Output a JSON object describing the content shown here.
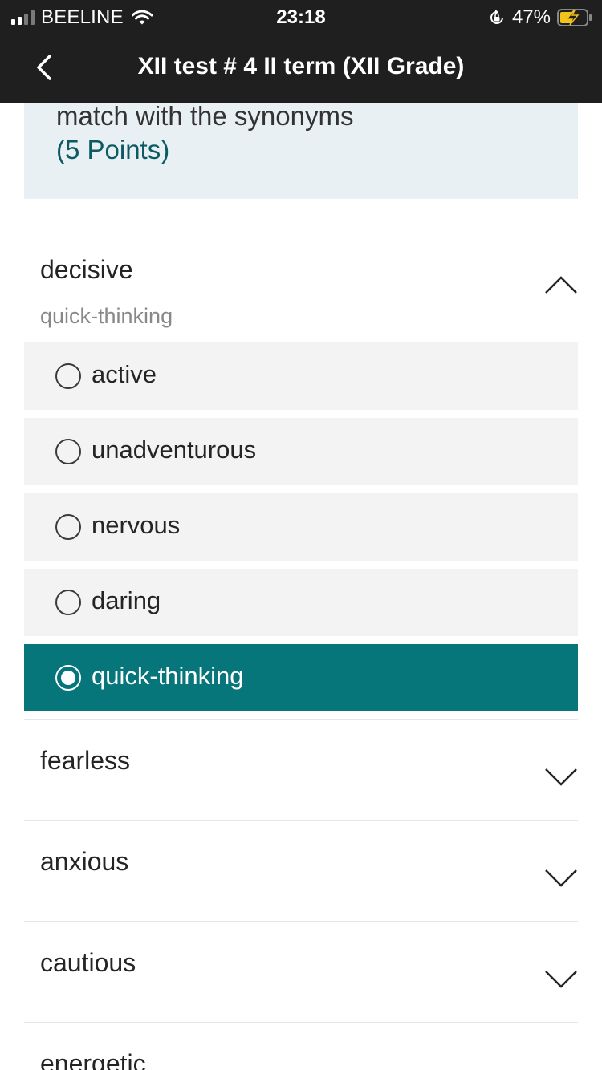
{
  "status_bar": {
    "carrier": "BEELINE",
    "time": "23:18",
    "battery": "47%"
  },
  "nav": {
    "title": "XII test # 4 II term (XII Grade)"
  },
  "question": {
    "text": "match with the synonyms",
    "points": "(5 Points)"
  },
  "match_items": [
    {
      "word": "decisive",
      "selected_answer": "quick-thinking",
      "expanded": true,
      "options": [
        {
          "label": "active",
          "selected": false
        },
        {
          "label": "unadventurous",
          "selected": false
        },
        {
          "label": "nervous",
          "selected": false
        },
        {
          "label": "daring",
          "selected": false
        },
        {
          "label": "quick-thinking",
          "selected": true
        }
      ]
    },
    {
      "word": "fearless",
      "expanded": false
    },
    {
      "word": "anxious",
      "expanded": false
    },
    {
      "word": "cautious",
      "expanded": false
    },
    {
      "word": "energetic",
      "expanded": false
    }
  ],
  "colors": {
    "header_bg": "#1f1f1f",
    "card_bg": "#e8f0f3",
    "accent": "#06767b",
    "points_text": "#0c5a62",
    "option_bg": "#f3f3f3"
  },
  "icons": {
    "back": "chevron-left-icon",
    "collapse": "chevron-up-icon",
    "expand": "chevron-down-icon",
    "wifi": "wifi-icon",
    "orientation_lock": "orientation-lock-icon",
    "battery": "battery-charging-icon"
  }
}
